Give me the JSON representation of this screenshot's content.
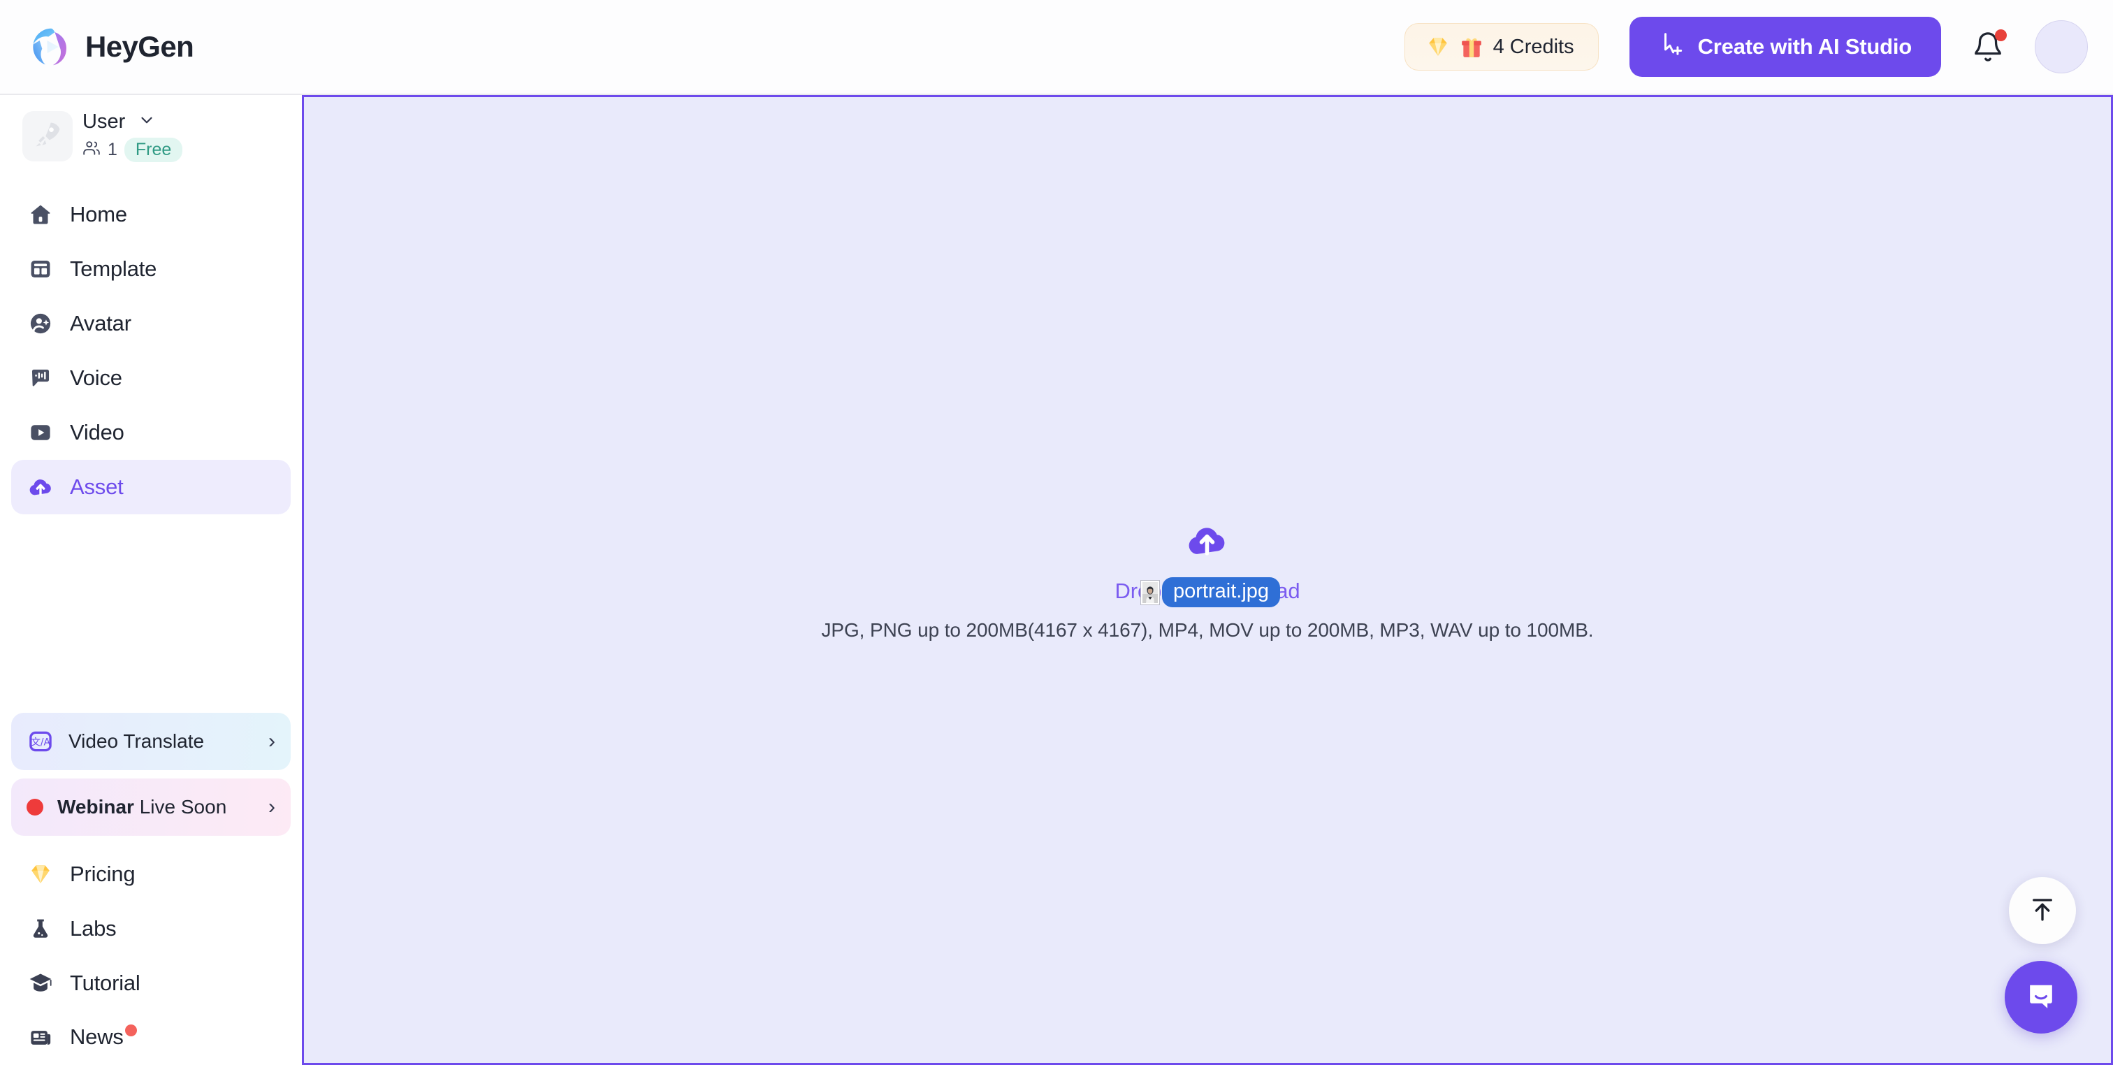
{
  "header": {
    "brand_name": "HeyGen",
    "brand_logo_icon": "heygen-logo-icon",
    "credits": {
      "label": "4 Credits",
      "gem_icon": "gem-icon",
      "gift_icon": "gift-icon"
    },
    "create_button": {
      "label": "Create with AI Studio",
      "icon": "cursor-plus-icon",
      "color": "#6d4aec"
    },
    "notification_icon": "bell-icon",
    "notification_badge_color": "#e8413a",
    "avatar_icon": "user-avatar"
  },
  "sidebar": {
    "workspace": {
      "avatar_icon": "rocket-icon",
      "name": "User",
      "chevron_icon": "chevron-down-icon",
      "members_icon": "people-icon",
      "member_count": "1",
      "plan": "Free",
      "plan_color": "#2f9a84"
    },
    "nav": [
      {
        "label": "Home",
        "icon": "home-icon",
        "active": false
      },
      {
        "label": "Template",
        "icon": "template-icon",
        "active": false
      },
      {
        "label": "Avatar",
        "icon": "avatar-icon",
        "active": false
      },
      {
        "label": "Voice",
        "icon": "voice-icon",
        "active": false
      },
      {
        "label": "Video",
        "icon": "video-icon",
        "active": false
      },
      {
        "label": "Asset",
        "icon": "cloud-upload-icon",
        "active": true
      }
    ],
    "promos": [
      {
        "label": "Video Translate",
        "icon": "translate-icon",
        "chevron": "›"
      },
      {
        "label_bold": "Webinar",
        "label_rest": "Live Soon",
        "icon": "live-dot-icon",
        "chevron": "›"
      }
    ],
    "bottom_nav": [
      {
        "label": "Pricing",
        "icon": "gem-icon"
      },
      {
        "label": "Labs",
        "icon": "flask-icon"
      },
      {
        "label": "Tutorial",
        "icon": "graduation-cap-icon"
      },
      {
        "label": "News",
        "icon": "newspaper-icon",
        "badge": true
      }
    ]
  },
  "main": {
    "drop_cloud_icon": "cloud-upload-icon",
    "drop_title": "Drop files to upload",
    "drop_hint": "JPG, PNG up to 200MB(4167 x 4167), MP4, MOV up to 200MB, MP3, WAV up to 100MB.",
    "accent_color": "#6d4aec",
    "background_color": "#e9eafb",
    "drag_ghost": {
      "filename": "portrait.jpg",
      "thumb_icon": "image-thumbnail",
      "pill_color": "#2f6fd6"
    }
  },
  "floating": {
    "scroll_top_button_icon": "arrow-up-to-bar-icon",
    "chat_button_icon": "chat-bubble-icon",
    "chat_button_color": "#6d4aec"
  }
}
